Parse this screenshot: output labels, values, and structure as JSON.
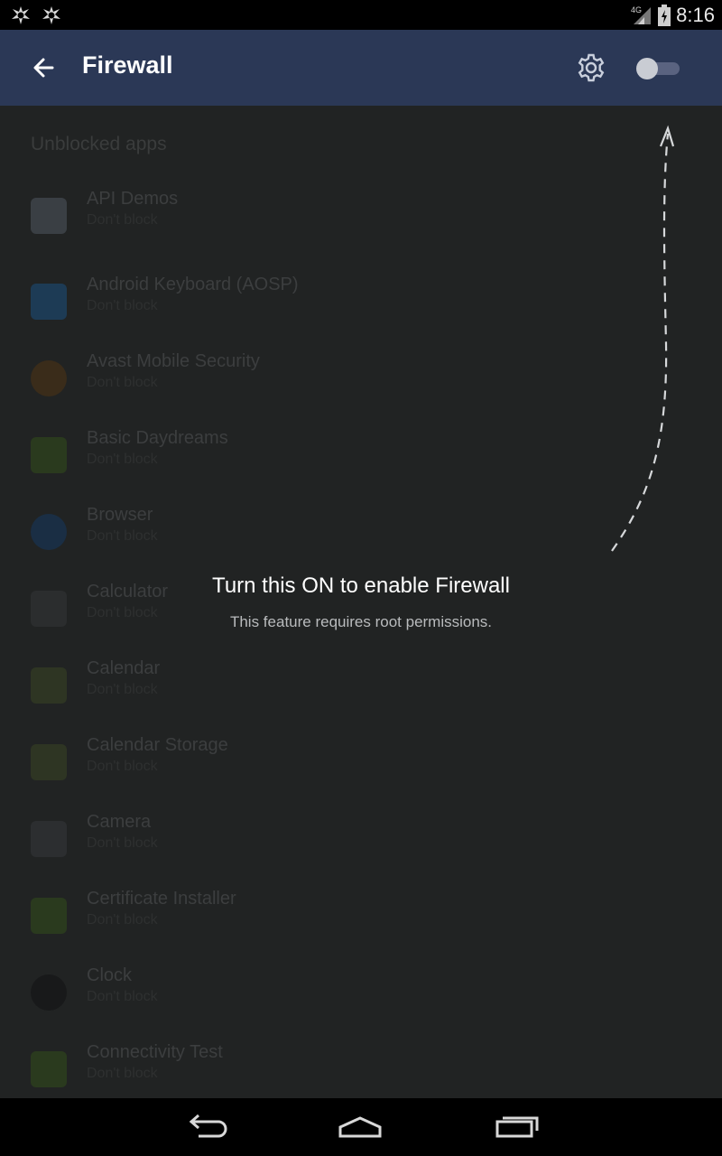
{
  "status_bar": {
    "left_icons": [
      "avast-notification-icon",
      "avast-notification-icon"
    ],
    "network": "4G",
    "time": "8:16"
  },
  "toolbar": {
    "title": "Firewall",
    "back_icon": "arrow-back-icon",
    "settings_icon": "gear-icon",
    "toggle_state": "off"
  },
  "list": {
    "section_header": "Unblocked apps",
    "items": [
      {
        "name": "API Demos",
        "sub": "Don't block",
        "icon": "android-app-icon",
        "color": "#3a3f44"
      },
      {
        "name": "Android Keyboard (AOSP)",
        "sub": "Don't block",
        "icon": "keyboard-icon",
        "color": "#1d3b55"
      },
      {
        "name": "Avast Mobile Security",
        "sub": "Don't block",
        "icon": "avast-icon",
        "color": "#3a2c1a"
      },
      {
        "name": "Basic Daydreams",
        "sub": "Don't block",
        "icon": "android-icon",
        "color": "#2a3a1e"
      },
      {
        "name": "Browser",
        "sub": "Don't block",
        "icon": "globe-icon",
        "color": "#1a2e44"
      },
      {
        "name": "Calculator",
        "sub": "Don't block",
        "icon": "calculator-icon",
        "color": "#2b2d2e"
      },
      {
        "name": "Calendar",
        "sub": "Don't block",
        "icon": "calendar-icon",
        "color": "#2e3523"
      },
      {
        "name": "Calendar Storage",
        "sub": "Don't block",
        "icon": "calendar-icon",
        "color": "#2e3523"
      },
      {
        "name": "Camera",
        "sub": "Don't block",
        "icon": "camera-icon",
        "color": "#2c2e30"
      },
      {
        "name": "Certificate Installer",
        "sub": "Don't block",
        "icon": "android-icon",
        "color": "#2a3a1e"
      },
      {
        "name": "Clock",
        "sub": "Don't block",
        "icon": "clock-icon",
        "color": "#18191a"
      },
      {
        "name": "Connectivity Test",
        "sub": "Don't block",
        "icon": "android-icon",
        "color": "#2a3a1e"
      }
    ]
  },
  "overlay": {
    "title": "Turn this ON to enable Firewall",
    "subtitle": "This feature requires root permissions."
  },
  "nav_bar": {
    "buttons": [
      "back-nav-icon",
      "home-nav-icon",
      "recents-nav-icon"
    ]
  },
  "colors": {
    "toolbar": "#2b3856",
    "status_bar": "#000000",
    "content_dim": "#212323"
  }
}
